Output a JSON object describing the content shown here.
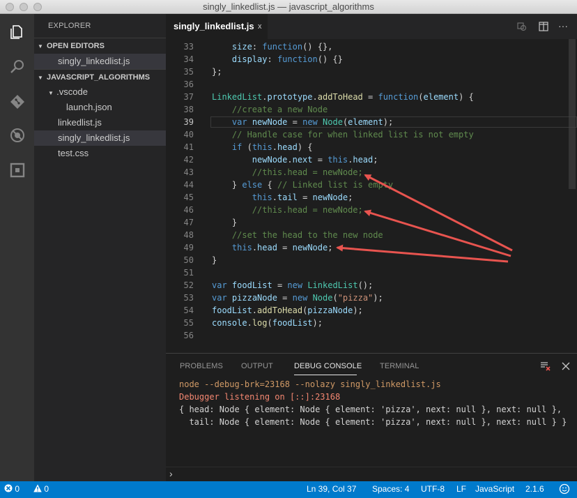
{
  "window": {
    "title": "singly_linkedlist.js — javascript_algorithms"
  },
  "activity_bar": {
    "icons": [
      "explorer-icon",
      "search-icon",
      "git-icon",
      "debug-icon",
      "extensions-icon"
    ]
  },
  "sidebar": {
    "title": "EXPLORER",
    "open_editors": {
      "label": "OPEN EDITORS",
      "items": [
        "singly_linkedlist.js"
      ]
    },
    "project": {
      "label": "JAVASCRIPT_ALGORITHMS",
      "folder": ".vscode",
      "folder_children": [
        "launch.json"
      ],
      "files": [
        "linkedlist.js",
        "singly_linkedlist.js",
        "test.css"
      ]
    }
  },
  "editor": {
    "active_tab": "singly_linkedlist.js",
    "close_glyph": "x",
    "line_numbers": [
      "33",
      "34",
      "35",
      "36",
      "37",
      "38",
      "39",
      "40",
      "41",
      "42",
      "43",
      "44",
      "45",
      "46",
      "47",
      "48",
      "49",
      "50",
      "51",
      "52",
      "53",
      "54",
      "55",
      "56"
    ],
    "current_line": "39"
  },
  "panel": {
    "tabs": [
      "PROBLEMS",
      "OUTPUT",
      "DEBUG CONSOLE",
      "TERMINAL"
    ],
    "active_tab": "DEBUG CONSOLE",
    "output": [
      "node --debug-brk=23168 --nolazy singly_linkedlist.js",
      "Debugger listening on [::]:23168",
      "{ head: Node { element: Node { element: 'pizza', next: null }, next: null },",
      "  tail: Node { element: Node { element: 'pizza', next: null }, next: null } }"
    ],
    "prompt": "›"
  },
  "status_bar": {
    "errors": "0",
    "warnings": "0",
    "position": "Ln 39, Col 37",
    "spaces": "Spaces: 4",
    "encoding": "UTF-8",
    "eol": "LF",
    "language": "JavaScript",
    "version": "2.1.6"
  },
  "colors": {
    "accent": "#007acc",
    "annotation_arrow": "#e8544f"
  }
}
